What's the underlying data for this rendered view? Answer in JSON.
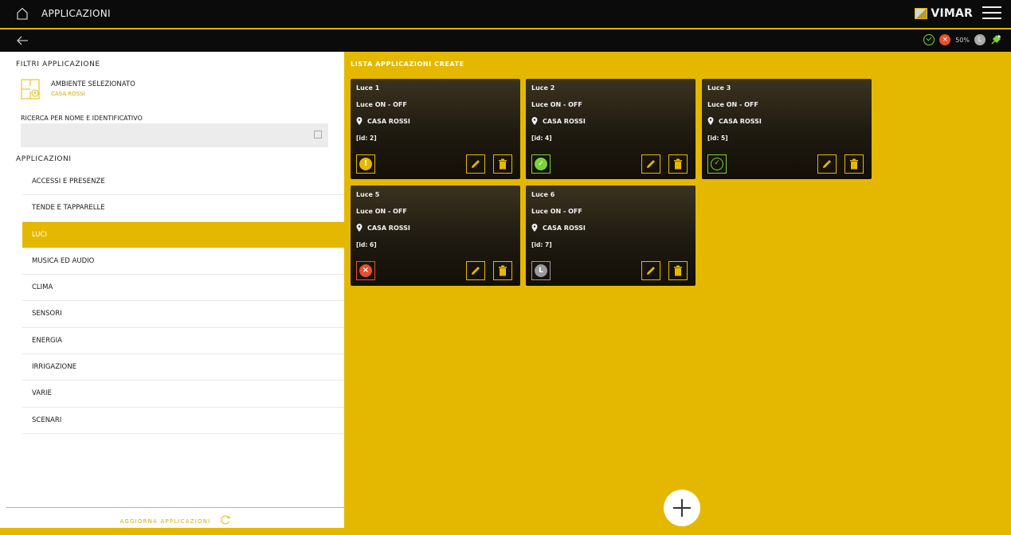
{
  "topbar": {
    "title": "APPLICAZIONI",
    "brand": "VIMAR"
  },
  "status": {
    "percent": "50%",
    "l_badge": "L",
    "err_badge": "×"
  },
  "sidebar": {
    "filters_title": "FILTRI APPLICAZIONE",
    "environment_label": "AMBIENTE SELEZIONATO",
    "environment_value": "CASA ROSSI",
    "search_label": "RICERCA PER NOME E IDENTIFICATIVO",
    "search_value": "",
    "apps_title": "APPLICAZIONI",
    "items": [
      {
        "label": "ACCESSI E PRESENZE",
        "active": false
      },
      {
        "label": "TENDE E TAPPARELLE",
        "active": false
      },
      {
        "label": "LUCI",
        "active": true
      },
      {
        "label": "MUSICA ED AUDIO",
        "active": false
      },
      {
        "label": "CLIMA",
        "active": false
      },
      {
        "label": "SENSORI",
        "active": false
      },
      {
        "label": "ENERGIA",
        "active": false
      },
      {
        "label": "IRRIGAZIONE",
        "active": false
      },
      {
        "label": "VARIE",
        "active": false
      },
      {
        "label": "SCENARI",
        "active": false
      }
    ],
    "refresh_label": "AGGIORNA APPLICAZIONI"
  },
  "main": {
    "list_title": "LISTA APPLICAZIONI CREATE",
    "cards": [
      {
        "title": "Luce 1",
        "type": "Luce ON - OFF",
        "location": "CASA ROSSI",
        "id": "[id: 2]",
        "status": "warning",
        "status_glyph": "!"
      },
      {
        "title": "Luce 2",
        "type": "Luce ON - OFF",
        "location": "CASA ROSSI",
        "id": "[id: 4]",
        "status": "ok-filled",
        "status_glyph": "✓"
      },
      {
        "title": "Luce 3",
        "type": "Luce ON - OFF",
        "location": "CASA ROSSI",
        "id": "[id: 5]",
        "status": "ok-outline",
        "status_glyph": "✓"
      },
      {
        "title": "Luce 5",
        "type": "Luce ON - OFF",
        "location": "CASA ROSSI",
        "id": "[id: 6]",
        "status": "error",
        "status_glyph": "×"
      },
      {
        "title": "Luce 6",
        "type": "Luce ON - OFF",
        "location": "CASA ROSSI",
        "id": "[id: 7]",
        "status": "pending",
        "status_glyph": "L"
      }
    ]
  },
  "colors": {
    "accent": "#e5b800",
    "ok": "#7bd33a",
    "error": "#e8502b",
    "pending": "#9a9a9a",
    "warning": "#e5b800"
  }
}
